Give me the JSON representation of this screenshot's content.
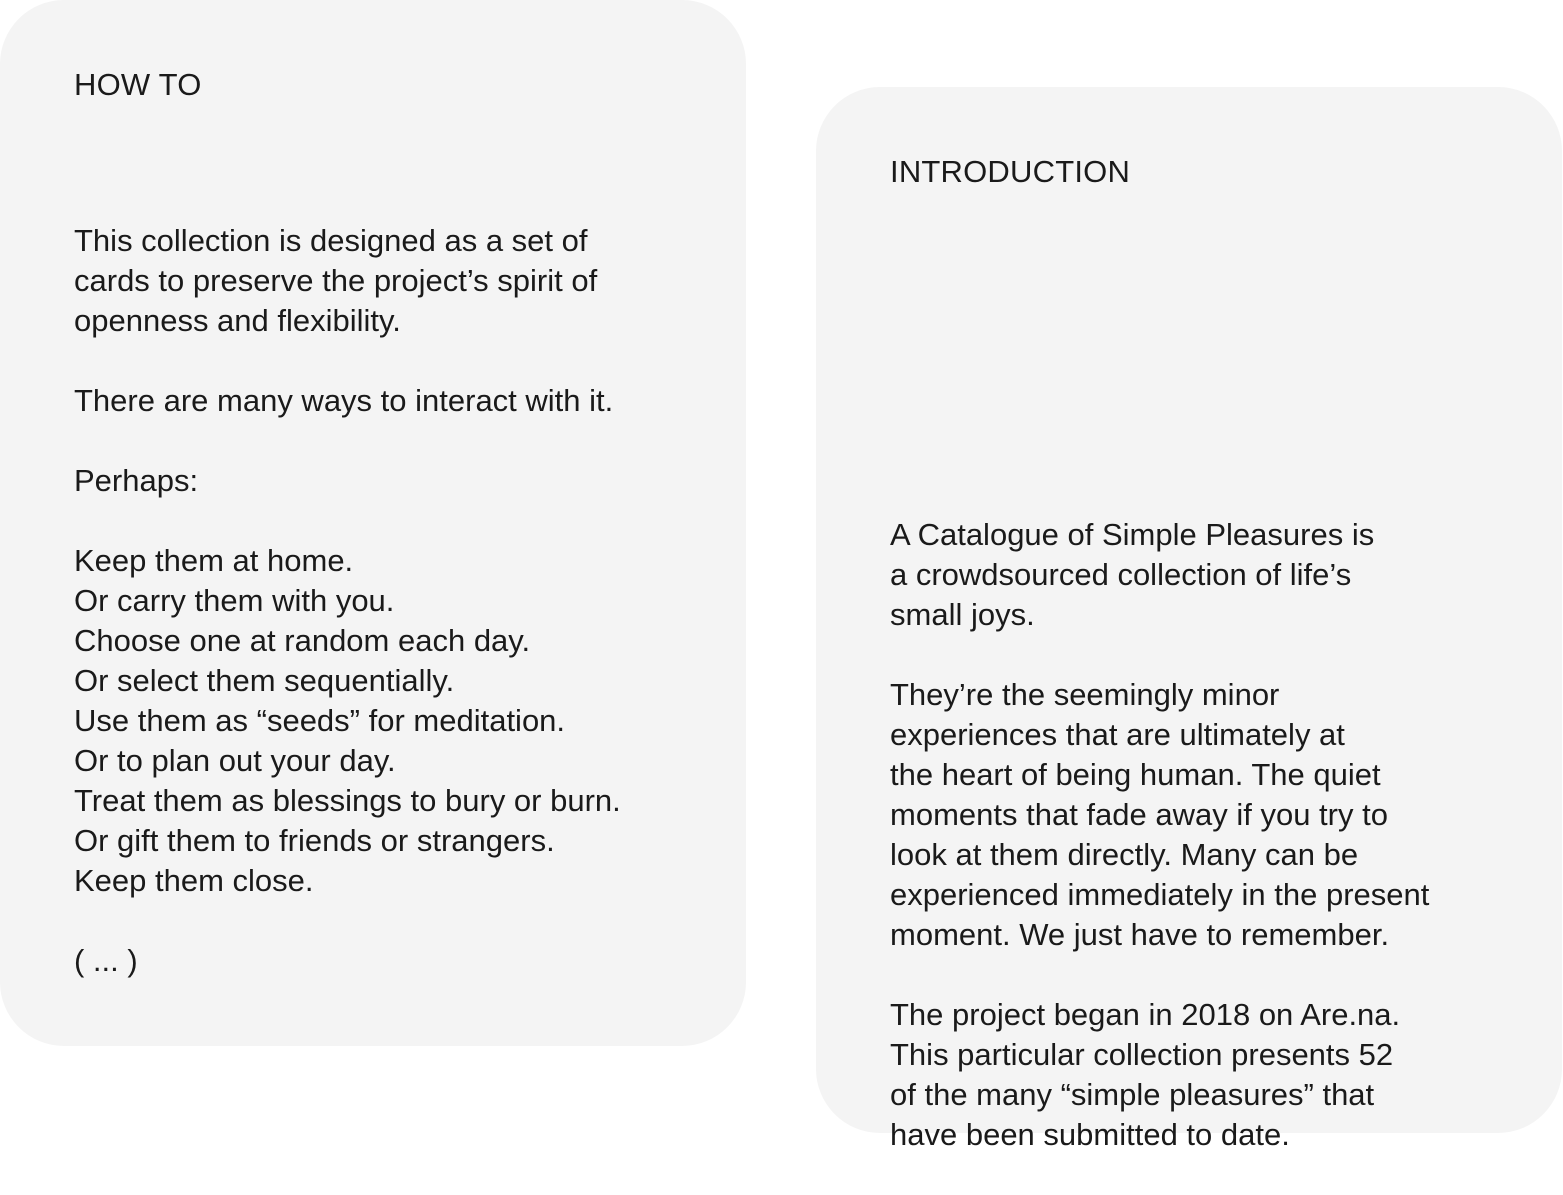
{
  "how_to": {
    "heading": "HOW TO",
    "paragraphs": [
      [
        "This collection is designed as a set of",
        "cards to preserve the project’s spirit of",
        "openness and flexibility."
      ],
      [
        "There are many ways to interact with it."
      ],
      [
        "Perhaps:"
      ],
      [
        "Keep them at home.",
        "Or carry them with you.",
        "Choose one at random each day.",
        "Or select them sequentially.",
        "Use them as “seeds” for meditation.",
        "Or to plan out your day.",
        "Treat them as blessings to bury or burn.",
        "Or gift them to friends or strangers.",
        "Keep them close."
      ],
      [
        "( ... )"
      ]
    ]
  },
  "introduction": {
    "heading": "INTRODUCTION",
    "paragraphs": [
      [
        "A Catalogue of Simple Pleasures is",
        "a crowdsourced collection of life’s",
        "small joys."
      ],
      [
        "They’re the seemingly minor",
        "experiences that are ultimately at",
        "the heart of being human. The quiet",
        "moments that fade away if you try to",
        "look at them directly. Many can be",
        "experienced immediately in the present",
        "moment. We just have to remember."
      ],
      [
        "The project began in 2018 on Are.na.",
        "This particular collection presents 52",
        "of the many “simple pleasures” that",
        "have been submitted to date."
      ]
    ]
  }
}
